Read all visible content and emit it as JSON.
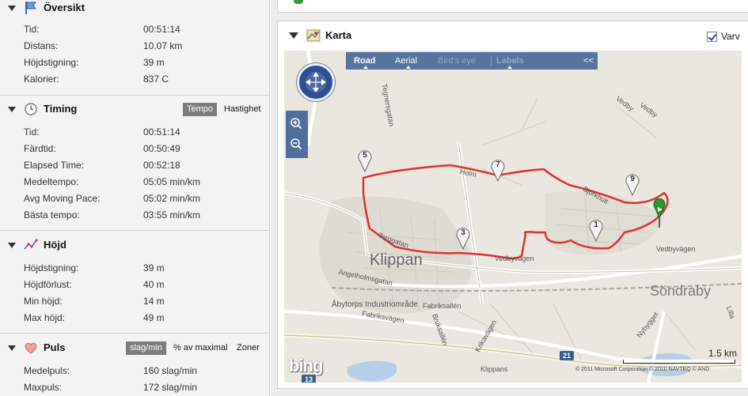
{
  "oversikt": {
    "title": "Översikt",
    "rows": [
      {
        "label": "Tid:",
        "value": "00:51:14"
      },
      {
        "label": "Distans:",
        "value": "10.07 km"
      },
      {
        "label": "Höjdstigning:",
        "value": "39 m"
      },
      {
        "label": "Kalorier:",
        "value": "837 C"
      }
    ]
  },
  "timing": {
    "title": "Timing",
    "toggle": {
      "active": "Tempo",
      "inactive": "Hastighet"
    },
    "rows": [
      {
        "label": "Tid:",
        "value": "00:51:14"
      },
      {
        "label": "Färdtid:",
        "value": "00:50:49"
      },
      {
        "label": "Elapsed Time:",
        "value": "00:52:18"
      },
      {
        "label": "Medeltempo:",
        "value": "05:05 min/km"
      },
      {
        "label": "Avg Moving Pace:",
        "value": "05:02 min/km"
      },
      {
        "label": "Bästa tempo:",
        "value": "03:55 min/km"
      }
    ]
  },
  "hojd": {
    "title": "Höjd",
    "rows": [
      {
        "label": "Höjdstigning:",
        "value": "39 m"
      },
      {
        "label": "Höjdförlust:",
        "value": "40 m"
      },
      {
        "label": "Min höjd:",
        "value": "14 m"
      },
      {
        "label": "Max höjd:",
        "value": "49 m"
      }
    ]
  },
  "puls": {
    "title": "Puls",
    "toggle": {
      "active": "slag/min",
      "option2": "% av maximal",
      "option3": "Zoner"
    },
    "rows": [
      {
        "label": "Medelpuls:",
        "value": "160 slag/min"
      },
      {
        "label": "Maxpuls:",
        "value": "172 slag/min"
      }
    ]
  },
  "karta": {
    "title": "Karta",
    "varv_label": "Varv",
    "varv_checked": true,
    "nav": {
      "road": "Road",
      "aerial": "Aerial",
      "birdseye": "Bird's eye",
      "labels": "Labels",
      "collapse": "<<"
    },
    "pins": [
      "1",
      "3",
      "5",
      "7",
      "9"
    ],
    "places": {
      "klippan": "Klippan",
      "sondraby": "Söndraby",
      "holm": "Holm",
      "vedby1": "Vedby",
      "vedby2": "Vedby",
      "vedbyvagen1": "Vedbyvägen",
      "vedbyvagen2": "Vedbyvägen",
      "torggatan": "Torggatan",
      "angelholmsgatan": "Ängelholmsgatan",
      "abytorps": "Åbytorps Industriområde",
      "fabriksallen": "Fabriksallén",
      "fabriksvagen": "Fabriksvägen",
      "bruksallen": "Bruksallén",
      "krikavagen": "Krikavägen",
      "nybygget": "Nybygget",
      "klippans": "Klippans",
      "lilla": "Lilla",
      "tegnersgatan": "Tegnersgatan",
      "bjorkhult": "Björkhult"
    },
    "road_shields": {
      "r21": "21",
      "r13": "13"
    },
    "scale": "1.5 km",
    "bing": "bing",
    "copyright": "© 2011 Microsoft Corporation   © 2010 NAVTEQ   © AND"
  },
  "colors": {
    "route": "#e03030",
    "map_bg": "#e9e7df",
    "nav_bg": "#4e6f9c",
    "end_flag": "#2b9a2b"
  }
}
